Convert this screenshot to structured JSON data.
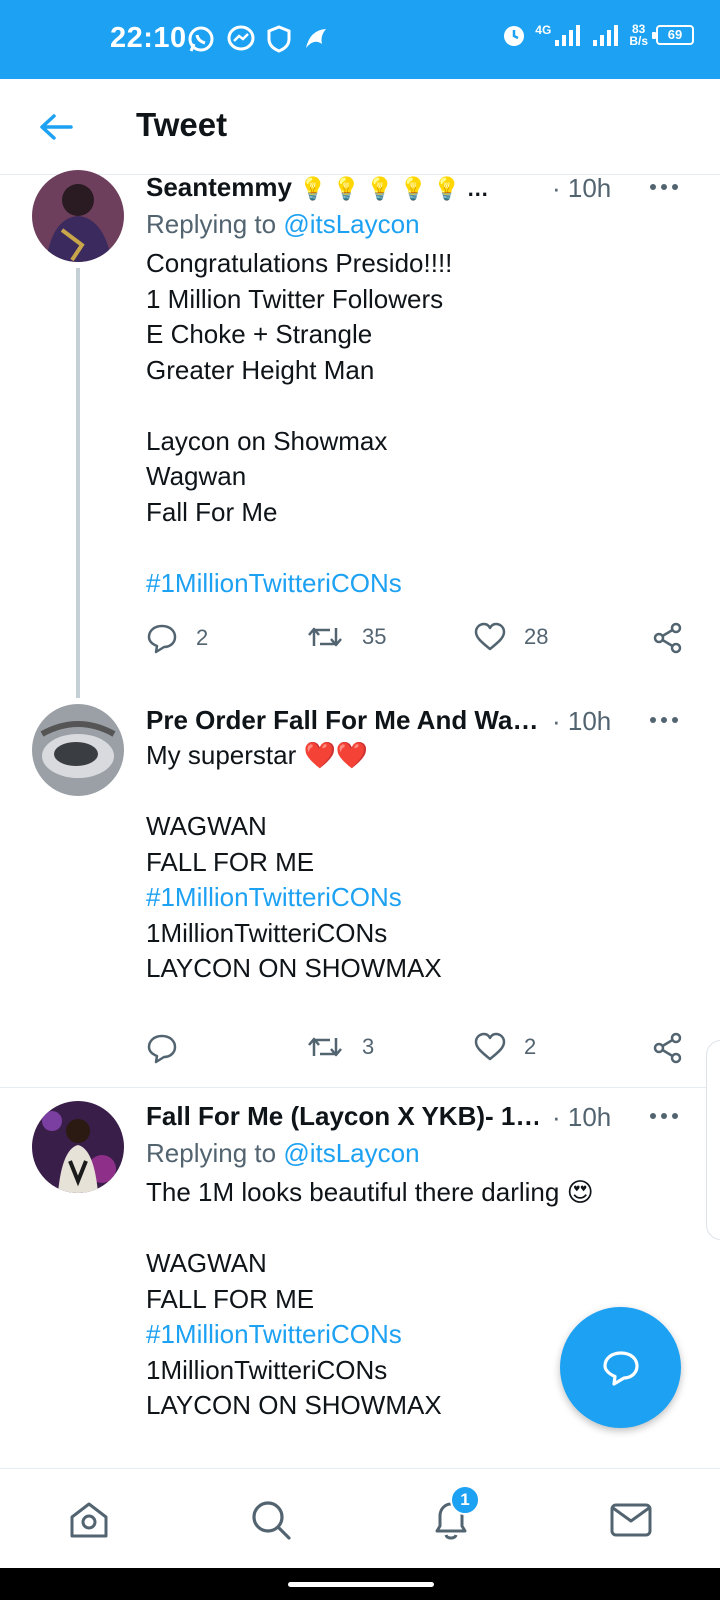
{
  "status_bar": {
    "time": "22:10",
    "network": "4G",
    "net_speed_value": "83",
    "net_speed_unit": "B/s",
    "battery": "69"
  },
  "header": {
    "title": "Tweet"
  },
  "tweets": [
    {
      "author": "Seantemmy",
      "author_emoji": "💡 💡 💡 💡 💡 …",
      "time": "· 10h",
      "reply_prefix": "Replying to ",
      "reply_handle": "@itsLaycon",
      "lines": [
        "Congratulations Presido!!!!",
        "1 Million Twitter Followers",
        "E Choke + Strangle",
        "Greater Height Man",
        "",
        "Laycon on Showmax",
        "Wagwan",
        "Fall For Me",
        "",
        "#1MillionTwitteriCONs"
      ],
      "replies": "2",
      "retweets": "35",
      "likes": "28"
    },
    {
      "author": "Pre Order Fall For Me And Wa…",
      "time": "· 10h",
      "text_main": "My superstar ",
      "text_emoji": "❤️❤️",
      "lines": [
        "",
        "WAGWAN",
        "FALL FOR ME",
        "#1MillionTwitteriCONs",
        "1MillionTwitteriCONs",
        "LAYCON ON SHOWMAX"
      ],
      "replies": "",
      "retweets": "3",
      "likes": "2"
    },
    {
      "author": "Fall For Me (Laycon X YKB)- 1…",
      "time": "· 10h",
      "reply_prefix": "Replying to ",
      "reply_handle": "@itsLaycon",
      "text_main": "The 1M looks beautiful there darling ",
      "text_emoji": "😍",
      "lines": [
        "",
        "WAGWAN",
        "FALL FOR ME",
        "#1MillionTwitteriCONs",
        "1MillionTwitteriCONs",
        "LAYCON ON SHOWMAX"
      ]
    }
  ],
  "bottom_nav": {
    "notification_badge": "1"
  },
  "colors": {
    "accent": "#1da1f2",
    "text": "#0f1419",
    "muted": "#536471",
    "divider": "#e6ecf0"
  },
  "icons": [
    "back-arrow-icon",
    "more-icon",
    "reply-icon",
    "retweet-icon",
    "like-icon",
    "share-icon",
    "compose-reply-icon",
    "home-icon",
    "search-icon",
    "notifications-icon",
    "messages-icon"
  ]
}
